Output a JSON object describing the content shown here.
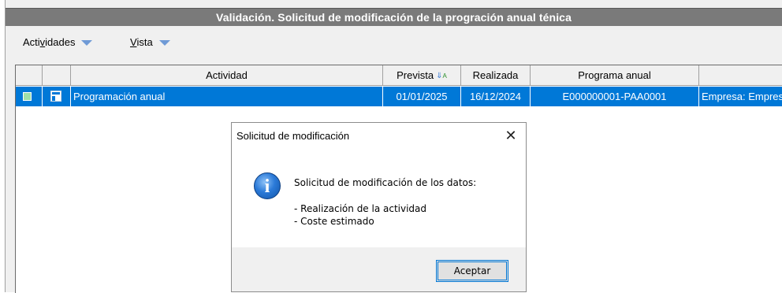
{
  "window": {
    "title": "Validación. Solicitud de modificación de la progración anual ténica"
  },
  "menu": {
    "items": [
      {
        "label_pre": "Acti",
        "label_acc": "v",
        "label_post": "idades"
      },
      {
        "label_pre": "",
        "label_acc": "V",
        "label_post": "ista"
      }
    ]
  },
  "grid": {
    "columns": [
      "",
      "",
      "Actividad",
      "Prevista",
      "Realizada",
      "Programa anual",
      ""
    ],
    "sort_column": "Prevista",
    "rows": [
      {
        "actividad": "Programación anual",
        "prevista": "01/01/2025",
        "realizada": "16/12/2024",
        "programa_anual": "E000000001-PAA0001",
        "extra": "Empresa: Empresa"
      }
    ],
    "selection_color": "#0078d7"
  },
  "dialog": {
    "title": "Solicitud de modificación",
    "close_glyph": "✕",
    "icon": "info-icon",
    "icon_glyph": "i",
    "message_heading": "Solicitud de modificación de los datos:",
    "message_lines": [
      "- Realización de la actividad",
      "- Coste estimado"
    ],
    "ok_label": "Aceptar"
  }
}
